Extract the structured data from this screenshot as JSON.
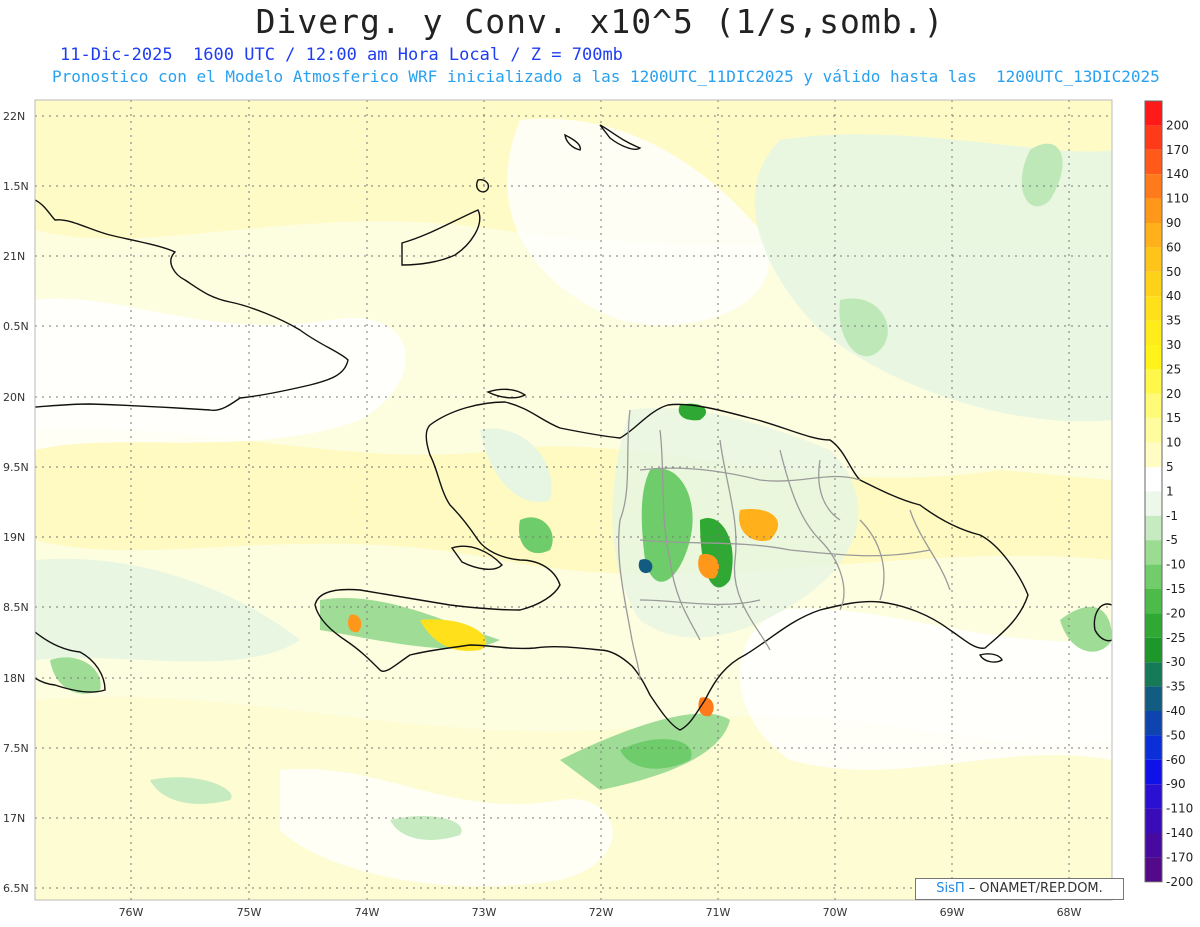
{
  "title": "Diverg. y Conv. x10^5 (1/s,somb.)",
  "subtitle_1": "11-Dic-2025  1600 UTC / 12:00 am Hora Local / Z = 700mb",
  "subtitle_2": "Pronostico con el Modelo Atmosferico WRF inicializado a las 1200UTC_11DIC2025 y válido hasta las  1200UTC_13DIC2025",
  "lat_labels": [
    "22N",
    "1.5N",
    "21N",
    "0.5N",
    "20N",
    "9.5N",
    "19N",
    "8.5N",
    "18N",
    "7.5N",
    "17N",
    "6.5N"
  ],
  "lon_labels": [
    "76W",
    "75W",
    "74W",
    "73W",
    "72W",
    "71W",
    "70W",
    "69W",
    "68W"
  ],
  "colorbar": {
    "labels": [
      "200",
      "170",
      "140",
      "110",
      "90",
      "60",
      "50",
      "40",
      "35",
      "30",
      "25",
      "20",
      "15",
      "10",
      "5",
      "1",
      "-1",
      "-5",
      "-10",
      "-15",
      "-20",
      "-25",
      "-30",
      "-35",
      "-40",
      "-50",
      "-60",
      "-90",
      "-110",
      "-140",
      "-170",
      "-200"
    ],
    "colors": [
      "#ff1a1a",
      "#ff3a1a",
      "#ff5a1a",
      "#ff7a1a",
      "#ff981a",
      "#ffb01a",
      "#ffc41a",
      "#ffd21a",
      "#ffe01a",
      "#ffec1a",
      "#fff31a",
      "#fff84a",
      "#fffb78",
      "#fffca0",
      "#fffdc4",
      "#ffffff",
      "#eef8ea",
      "#c6ebc0",
      "#9cdc92",
      "#72cc6c",
      "#4cbb4a",
      "#2fa934",
      "#1d962a",
      "#167a58",
      "#115c80",
      "#0d44b0",
      "#0a2fd8",
      "#1010e8",
      "#2a10d0",
      "#3a0cb8",
      "#460aa0",
      "#520a8a"
    ]
  },
  "credit": {
    "sis": "SisΠ",
    "rest": "– ONAMET/REP.DOM."
  }
}
